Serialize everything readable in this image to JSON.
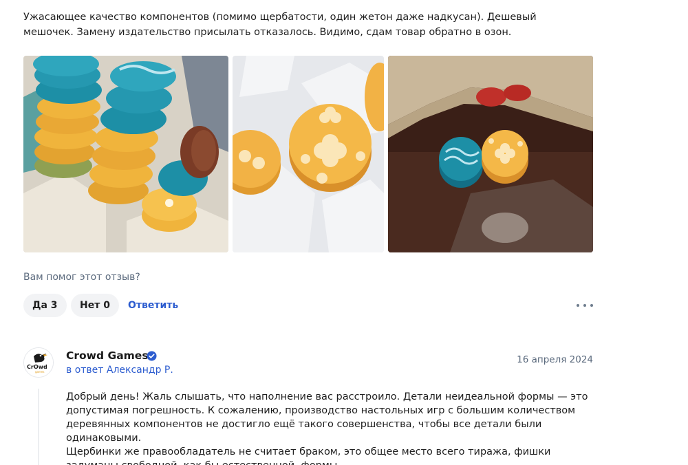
{
  "review": {
    "text": "Ужасающее качество компонентов (помимо щербатости, один жетон даже надкусан). Дешевый мешочек. Замену издательство присылать отказалось. Видимо, сдам товар обратно в озон."
  },
  "photos": [
    {
      "name": "photo-stacked-tokens"
    },
    {
      "name": "photo-chipped-yellow-tokens"
    },
    {
      "name": "photo-tokens-and-bag"
    }
  ],
  "feedback": {
    "question": "Вам помог этот отзыв?",
    "yes_label": "Да 3",
    "no_label": "Нет 0",
    "reply_label": "Ответить",
    "more_icon": "more-horizontal-icon"
  },
  "reply": {
    "author": "Crowd Games",
    "verified_icon": "verified-check-icon",
    "in_reply_to": "в ответ Александр Р.",
    "date": "16 апреля 2024",
    "text": "Добрый день! Жаль слышать, что наполнение вас расстроило. Детали неидеальной формы — это допустимая погрешность. К сожалению, производство настольных игр с большим количеством деревянных компонентов не достигло ещё такого совершенства, чтобы все детали были одинаковыми.\nЩербинки же правообладатель не считает браком, это общее место всего тиража, фишки задуманы свободной, как бы естественной, формы."
  },
  "colors": {
    "link": "#2c5ccf",
    "muted": "#5b6a7d",
    "pill_bg": "#f2f3f5",
    "token_teal": "#1d8fa6",
    "token_yellow": "#f0b43c",
    "token_brown": "#7a3b26"
  }
}
